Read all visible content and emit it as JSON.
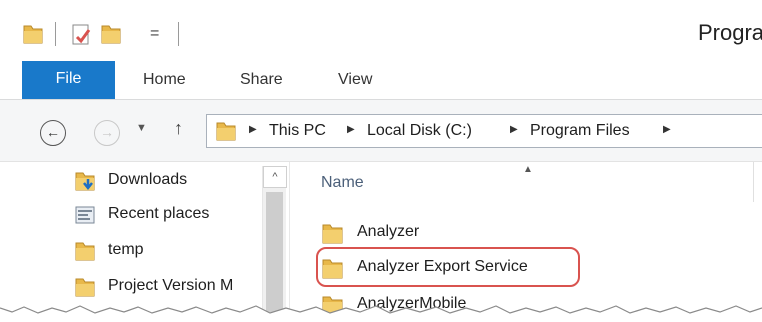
{
  "titlebar": {
    "title": "Progra",
    "quick_access_arrow": "="
  },
  "ribbon": {
    "tabs": [
      {
        "label": "File"
      },
      {
        "label": "Home"
      },
      {
        "label": "Share"
      },
      {
        "label": "View"
      }
    ]
  },
  "navigation": {
    "back_glyph": "←",
    "forward_glyph": "→",
    "recent_glyph": "▼",
    "up_glyph": "↑"
  },
  "address": {
    "crumbs": [
      "This PC",
      "Local Disk (C:)",
      "Program Files"
    ],
    "separator": "▶"
  },
  "nav_pane": {
    "items": [
      {
        "label": "Downloads",
        "icon": "downloads-folder-icon"
      },
      {
        "label": "Recent places",
        "icon": "recent-places-icon"
      },
      {
        "label": "temp",
        "icon": "folder-icon"
      },
      {
        "label": "Project Version M",
        "icon": "folder-icon"
      }
    ],
    "scroll_up_glyph": "^"
  },
  "file_list": {
    "column_name": "Name",
    "sort_glyph": "▲",
    "items": [
      {
        "label": "Analyzer"
      },
      {
        "label": "Analyzer Export Service"
      },
      {
        "label": "AnalyzerMobile"
      }
    ]
  },
  "colors": {
    "file_tab": "#1979ca",
    "highlight": "#d9534f",
    "folder": "#e8b84a"
  }
}
